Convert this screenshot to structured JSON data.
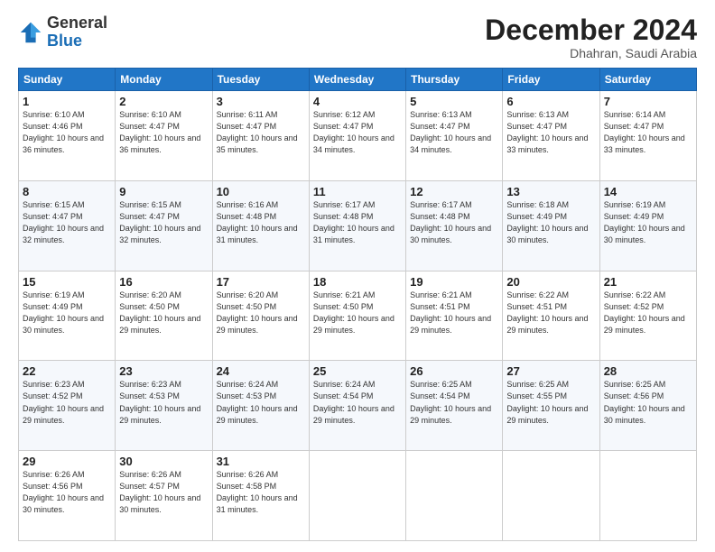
{
  "logo": {
    "general": "General",
    "blue": "Blue"
  },
  "header": {
    "month": "December 2024",
    "location": "Dhahran, Saudi Arabia"
  },
  "days_of_week": [
    "Sunday",
    "Monday",
    "Tuesday",
    "Wednesday",
    "Thursday",
    "Friday",
    "Saturday"
  ],
  "weeks": [
    [
      {
        "day": "1",
        "sunrise": "6:10 AM",
        "sunset": "4:46 PM",
        "daylight": "10 hours and 36 minutes."
      },
      {
        "day": "2",
        "sunrise": "6:10 AM",
        "sunset": "4:47 PM",
        "daylight": "10 hours and 36 minutes."
      },
      {
        "day": "3",
        "sunrise": "6:11 AM",
        "sunset": "4:47 PM",
        "daylight": "10 hours and 35 minutes."
      },
      {
        "day": "4",
        "sunrise": "6:12 AM",
        "sunset": "4:47 PM",
        "daylight": "10 hours and 34 minutes."
      },
      {
        "day": "5",
        "sunrise": "6:13 AM",
        "sunset": "4:47 PM",
        "daylight": "10 hours and 34 minutes."
      },
      {
        "day": "6",
        "sunrise": "6:13 AM",
        "sunset": "4:47 PM",
        "daylight": "10 hours and 33 minutes."
      },
      {
        "day": "7",
        "sunrise": "6:14 AM",
        "sunset": "4:47 PM",
        "daylight": "10 hours and 33 minutes."
      }
    ],
    [
      {
        "day": "8",
        "sunrise": "6:15 AM",
        "sunset": "4:47 PM",
        "daylight": "10 hours and 32 minutes."
      },
      {
        "day": "9",
        "sunrise": "6:15 AM",
        "sunset": "4:47 PM",
        "daylight": "10 hours and 32 minutes."
      },
      {
        "day": "10",
        "sunrise": "6:16 AM",
        "sunset": "4:48 PM",
        "daylight": "10 hours and 31 minutes."
      },
      {
        "day": "11",
        "sunrise": "6:17 AM",
        "sunset": "4:48 PM",
        "daylight": "10 hours and 31 minutes."
      },
      {
        "day": "12",
        "sunrise": "6:17 AM",
        "sunset": "4:48 PM",
        "daylight": "10 hours and 30 minutes."
      },
      {
        "day": "13",
        "sunrise": "6:18 AM",
        "sunset": "4:49 PM",
        "daylight": "10 hours and 30 minutes."
      },
      {
        "day": "14",
        "sunrise": "6:19 AM",
        "sunset": "4:49 PM",
        "daylight": "10 hours and 30 minutes."
      }
    ],
    [
      {
        "day": "15",
        "sunrise": "6:19 AM",
        "sunset": "4:49 PM",
        "daylight": "10 hours and 30 minutes."
      },
      {
        "day": "16",
        "sunrise": "6:20 AM",
        "sunset": "4:50 PM",
        "daylight": "10 hours and 29 minutes."
      },
      {
        "day": "17",
        "sunrise": "6:20 AM",
        "sunset": "4:50 PM",
        "daylight": "10 hours and 29 minutes."
      },
      {
        "day": "18",
        "sunrise": "6:21 AM",
        "sunset": "4:50 PM",
        "daylight": "10 hours and 29 minutes."
      },
      {
        "day": "19",
        "sunrise": "6:21 AM",
        "sunset": "4:51 PM",
        "daylight": "10 hours and 29 minutes."
      },
      {
        "day": "20",
        "sunrise": "6:22 AM",
        "sunset": "4:51 PM",
        "daylight": "10 hours and 29 minutes."
      },
      {
        "day": "21",
        "sunrise": "6:22 AM",
        "sunset": "4:52 PM",
        "daylight": "10 hours and 29 minutes."
      }
    ],
    [
      {
        "day": "22",
        "sunrise": "6:23 AM",
        "sunset": "4:52 PM",
        "daylight": "10 hours and 29 minutes."
      },
      {
        "day": "23",
        "sunrise": "6:23 AM",
        "sunset": "4:53 PM",
        "daylight": "10 hours and 29 minutes."
      },
      {
        "day": "24",
        "sunrise": "6:24 AM",
        "sunset": "4:53 PM",
        "daylight": "10 hours and 29 minutes."
      },
      {
        "day": "25",
        "sunrise": "6:24 AM",
        "sunset": "4:54 PM",
        "daylight": "10 hours and 29 minutes."
      },
      {
        "day": "26",
        "sunrise": "6:25 AM",
        "sunset": "4:54 PM",
        "daylight": "10 hours and 29 minutes."
      },
      {
        "day": "27",
        "sunrise": "6:25 AM",
        "sunset": "4:55 PM",
        "daylight": "10 hours and 29 minutes."
      },
      {
        "day": "28",
        "sunrise": "6:25 AM",
        "sunset": "4:56 PM",
        "daylight": "10 hours and 30 minutes."
      }
    ],
    [
      {
        "day": "29",
        "sunrise": "6:26 AM",
        "sunset": "4:56 PM",
        "daylight": "10 hours and 30 minutes."
      },
      {
        "day": "30",
        "sunrise": "6:26 AM",
        "sunset": "4:57 PM",
        "daylight": "10 hours and 30 minutes."
      },
      {
        "day": "31",
        "sunrise": "6:26 AM",
        "sunset": "4:58 PM",
        "daylight": "10 hours and 31 minutes."
      },
      null,
      null,
      null,
      null
    ]
  ]
}
